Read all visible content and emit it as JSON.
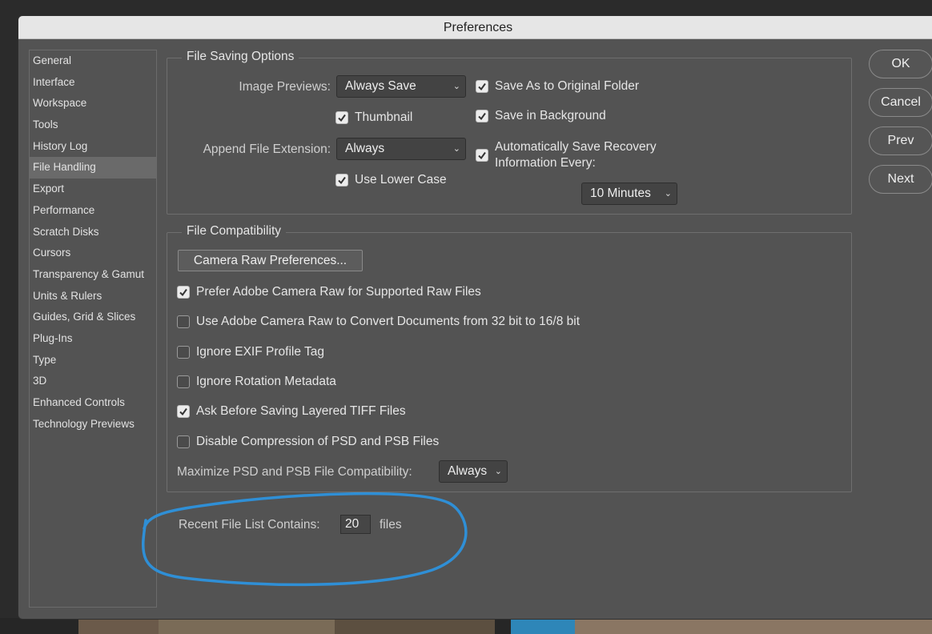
{
  "window": {
    "title": "Preferences"
  },
  "sidebar": {
    "items": [
      {
        "label": "General"
      },
      {
        "label": "Interface"
      },
      {
        "label": "Workspace"
      },
      {
        "label": "Tools"
      },
      {
        "label": "History Log"
      },
      {
        "label": "File Handling"
      },
      {
        "label": "Export"
      },
      {
        "label": "Performance"
      },
      {
        "label": "Scratch Disks"
      },
      {
        "label": "Cursors"
      },
      {
        "label": "Transparency & Gamut"
      },
      {
        "label": "Units & Rulers"
      },
      {
        "label": "Guides, Grid & Slices"
      },
      {
        "label": "Plug-Ins"
      },
      {
        "label": "Type"
      },
      {
        "label": "3D"
      },
      {
        "label": "Enhanced Controls"
      },
      {
        "label": "Technology Previews"
      }
    ],
    "selected": "File Handling"
  },
  "file_saving": {
    "legend": "File Saving Options",
    "image_previews_label": "Image Previews:",
    "image_previews_value": "Always Save",
    "thumbnail_label": "Thumbnail",
    "thumbnail_checked": true,
    "append_ext_label": "Append File Extension:",
    "append_ext_value": "Always",
    "lower_case_label": "Use Lower Case",
    "lower_case_checked": true,
    "save_original_label": "Save As to Original Folder",
    "save_original_checked": true,
    "save_background_label": "Save in Background",
    "save_background_checked": true,
    "auto_save_label_line1": "Automatically Save Recovery",
    "auto_save_label_line2": "Information Every:",
    "auto_save_checked": true,
    "auto_save_interval": "10 Minutes"
  },
  "file_compat": {
    "legend": "File Compatibility",
    "camera_raw_button": "Camera Raw Preferences...",
    "options": [
      {
        "label": "Prefer Adobe Camera Raw for Supported Raw Files",
        "checked": true
      },
      {
        "label": "Use Adobe Camera Raw to Convert Documents from 32 bit to 16/8 bit",
        "checked": false
      },
      {
        "label": "Ignore EXIF Profile Tag",
        "checked": false
      },
      {
        "label": "Ignore Rotation Metadata",
        "checked": false
      },
      {
        "label": "Ask Before Saving Layered TIFF Files",
        "checked": true
      },
      {
        "label": "Disable Compression of PSD and PSB Files",
        "checked": false
      }
    ],
    "maximize_label": "Maximize PSD and PSB File Compatibility:",
    "maximize_value": "Always"
  },
  "recent": {
    "label": "Recent File List Contains:",
    "value": "20",
    "suffix": "files"
  },
  "buttons": {
    "ok": "OK",
    "cancel": "Cancel",
    "prev": "Prev",
    "next": "Next"
  },
  "colors": {
    "panel": "#535353",
    "titlebar": "#e6e6e6",
    "annotation": "#2f8fd6"
  }
}
